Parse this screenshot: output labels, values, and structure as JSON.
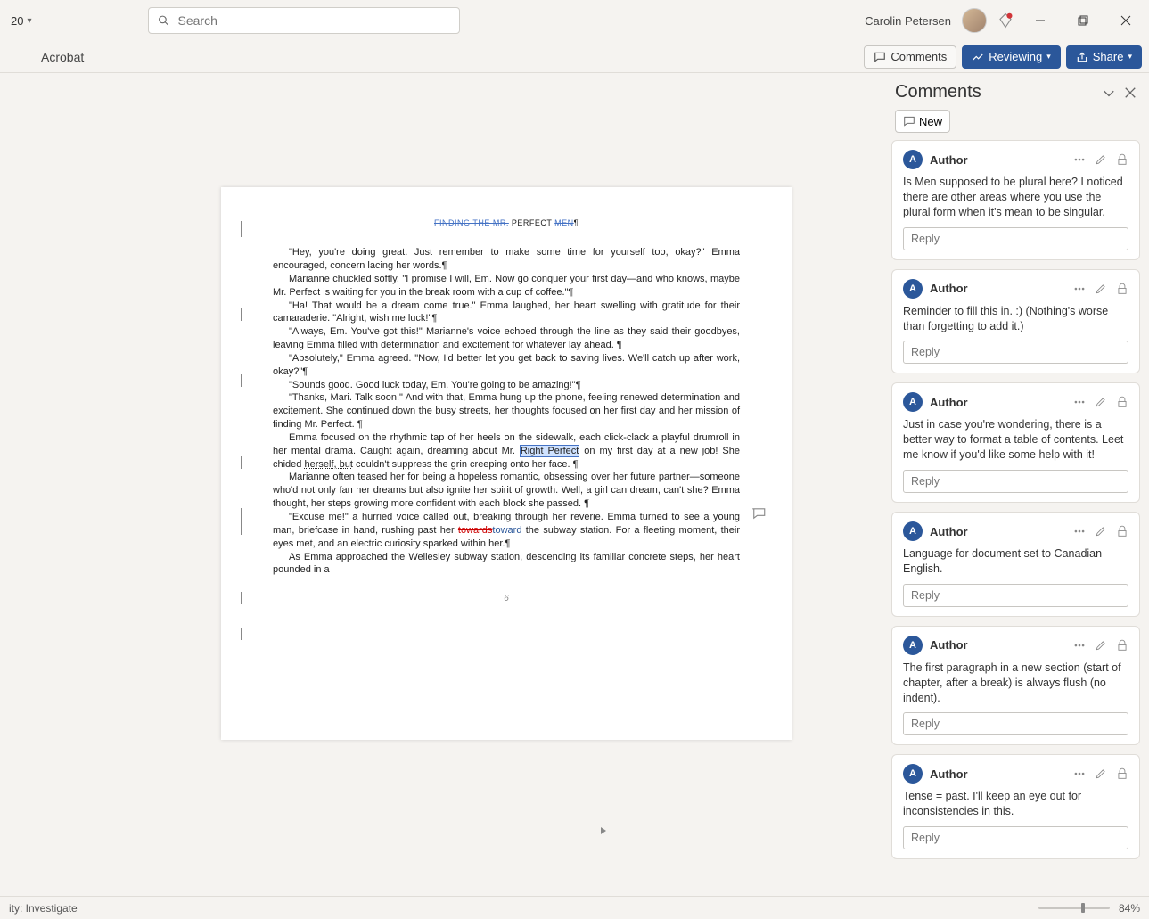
{
  "titlebar": {
    "zoom_value": "20",
    "search_placeholder": "Search",
    "user_name": "Carolin Petersen"
  },
  "ribbon": {
    "tab_acrobat": "Acrobat",
    "comments_btn": "Comments",
    "reviewing_btn": "Reviewing",
    "share_btn": "Share"
  },
  "comments_pane": {
    "title": "Comments",
    "new_btn": "New",
    "reply_placeholder": "Reply",
    "avatar_initial": "A",
    "items": [
      {
        "author": "Author",
        "text": "Is Men supposed to be plural here? I noticed there are other areas where you use the plural form when it's mean to be singular."
      },
      {
        "author": "Author",
        "text": "Reminder to fill this in. :) (Nothing's worse than forgetting to add it.)"
      },
      {
        "author": "Author",
        "text": "Just in case you're wondering, there is a better way to format a table of contents. Leet me know if you'd like some help with it!"
      },
      {
        "author": "Author",
        "text": "Language for document set to Canadian English."
      },
      {
        "author": "Author",
        "text": "The first paragraph in a new section (start of chapter, after a break) is always flush (no indent)."
      },
      {
        "author": "Author",
        "text": "Tense = past. I'll keep an eye out for inconsistencies in this."
      }
    ]
  },
  "document": {
    "header_pre": "FINDING THE MR.",
    "header_mid": " PERFECT ",
    "header_post": "MEN",
    "page_number": "6",
    "paragraphs": [
      "\"Hey, you're doing great. Just remember to make some time for yourself too, okay?\" Emma encouraged, concern lacing her words.¶",
      "Marianne chuckled softly. \"I promise I will, Em. Now go conquer your first day—and who knows, maybe Mr. Perfect is waiting for you in the break room with a cup of coffee.\"¶",
      "\"Ha! That would be a dream come true.\" Emma laughed, her heart swelling with gratitude for their camaraderie. \"Alright, wish me luck!\"¶",
      "\"Always, Em. You've got this!\" Marianne's voice echoed through the line as they said their goodbyes, leaving Emma filled with determination and excitement for whatever lay ahead. ¶",
      "\"Absolutely,\" Emma agreed. \"Now, I'd better let you get back to saving lives. We'll catch up after work, okay?\"¶",
      "\"Sounds good. Good luck today, Em. You're going to be amazing!\"¶",
      "\"Thanks, Mari. Talk soon.\" And with that, Emma hung up the phone, feeling renewed determination and excitement. She continued down the busy streets, her thoughts focused on her first day and her mission of finding Mr. Perfect. ¶",
      "Emma focused on the rhythmic tap of her heels on the sidewalk, each click-clack a playful drumroll in her mental drama. Caught again, dreaming about Mr. Right Perfect on my first day at a new job! She chided herself, but couldn't suppress the grin creeping onto her face. ¶",
      "Marianne often teased her for being a hopeless romantic, obsessing over her future partner—someone who'd not only fan her dreams but also ignite her spirit of growth. Well, a girl can dream, can't she? Emma thought, her steps growing more confident with each block she passed. ¶",
      "\"Excuse me!\" a hurried voice called out, breaking through her reverie. Emma turned to see a young man, briefcase in hand, rushing past her towardstoward the subway station. For a fleeting moment, their eyes met, and an electric curiosity sparked within her.¶",
      "As Emma approached the Wellesley subway station, descending its familiar concrete steps, her heart pounded in a"
    ]
  },
  "statusbar": {
    "accessibility": "ity: Investigate",
    "zoom_pct": "84%"
  }
}
